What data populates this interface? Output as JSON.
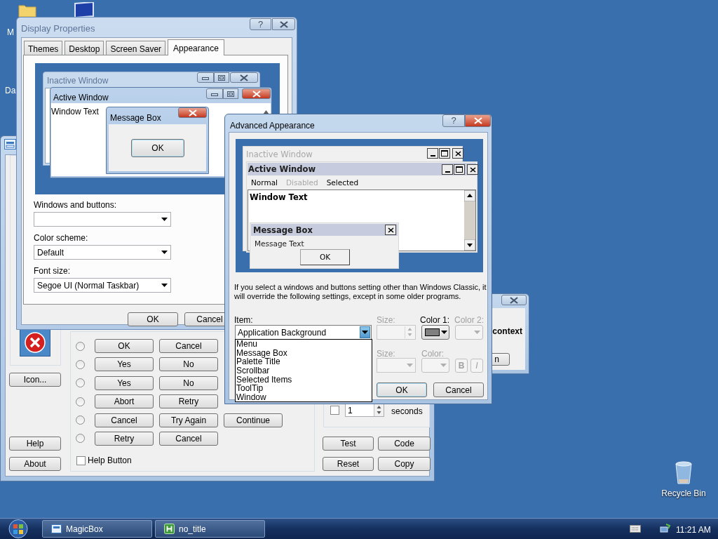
{
  "desktop": {
    "icons": [
      {
        "label": "M"
      },
      {
        "label": "Da"
      },
      {
        "label": "Recycle Bin"
      }
    ]
  },
  "magicbox": {
    "left_buttons": [
      "Icon...",
      "Help",
      "About"
    ],
    "rows": [
      {
        "selected": false,
        "buttons": [
          "OK",
          "Cancel"
        ]
      },
      {
        "selected": false,
        "buttons": [
          "Yes",
          "No"
        ]
      },
      {
        "selected": false,
        "buttons": [
          "Yes",
          "No"
        ]
      },
      {
        "selected": false,
        "buttons": [
          "Abort",
          "Retry"
        ]
      },
      {
        "selected": false,
        "buttons": [
          "Cancel",
          "Try Again",
          "Continue"
        ]
      },
      {
        "selected": false,
        "buttons": [
          "Retry",
          "Cancel"
        ]
      }
    ],
    "help_checkbox": {
      "label": "Help Button",
      "checked": false
    },
    "timeout": {
      "checked": false,
      "value": "1",
      "unit": "seconds"
    },
    "action_buttons": [
      "Test",
      "Code",
      "Reset",
      "Copy"
    ]
  },
  "context_window": {
    "text": "context",
    "button": "n"
  },
  "display_properties": {
    "title": "Display Properties",
    "active": false,
    "help_label": "?",
    "tabs": [
      {
        "label": "Themes",
        "selected": false
      },
      {
        "label": "Desktop",
        "selected": false
      },
      {
        "label": "Screen Saver",
        "selected": false
      },
      {
        "label": "Appearance",
        "selected": true
      }
    ],
    "preview": {
      "inactive_title": "Inactive Window",
      "active_title": "Active Window",
      "window_text": "Window Text",
      "message_title": "Message Box",
      "button": "OK"
    },
    "fields": [
      {
        "label": "Windows and buttons:"
      },
      {
        "label": "Color scheme:",
        "value": "Default"
      },
      {
        "label": "Font size:",
        "value": "Segoe UI (Normal Taskbar)"
      }
    ],
    "buttons": [
      "OK",
      "Cancel"
    ]
  },
  "advanced": {
    "title": "Advanced Appearance",
    "active": true,
    "help_label": "?",
    "preview": {
      "inactive_title": "Inactive Window",
      "active_title": "Active Window",
      "menu": [
        {
          "label": "Normal",
          "disabled": false
        },
        {
          "label": "Disabled",
          "disabled": true
        },
        {
          "label": "Selected",
          "disabled": false
        }
      ],
      "window_text": "Window Text",
      "message_title": "Message Box",
      "message_text": "Message Text",
      "button": "OK"
    },
    "note": "If you select a windows and buttons setting other than Windows Classic, it will override the following settings, except in some older programs.",
    "item": {
      "label": "Item:",
      "value": "Application Background",
      "expanded": true,
      "options": [
        {
          "label": "Menu",
          "selected": false
        },
        {
          "label": "Message Box",
          "selected": false
        },
        {
          "label": "Palette Title",
          "selected": false
        },
        {
          "label": "Scrollbar",
          "selected": false
        },
        {
          "label": "Selected Items",
          "selected": false
        },
        {
          "label": "ToolTip",
          "selected": false
        },
        {
          "label": "Window",
          "selected": false
        }
      ]
    },
    "size": {
      "label": "Size:",
      "disabled": true
    },
    "color1": {
      "label": "Color 1:",
      "disabled": false,
      "color": "#808080"
    },
    "color2": {
      "label": "Color 2:",
      "disabled": true
    },
    "font_size": {
      "label": "Size:",
      "disabled": true
    },
    "font_color": {
      "label": "Color:",
      "disabled": true
    },
    "bold": {
      "label": "B",
      "disabled": true
    },
    "italic": {
      "label": "I",
      "disabled": true
    },
    "buttons": [
      "OK",
      "Cancel"
    ]
  },
  "taskbar": {
    "buttons": [
      {
        "label": "MagicBox",
        "selected": false
      },
      {
        "label": "no_title",
        "selected": false
      }
    ],
    "clock": "11:21 AM"
  }
}
